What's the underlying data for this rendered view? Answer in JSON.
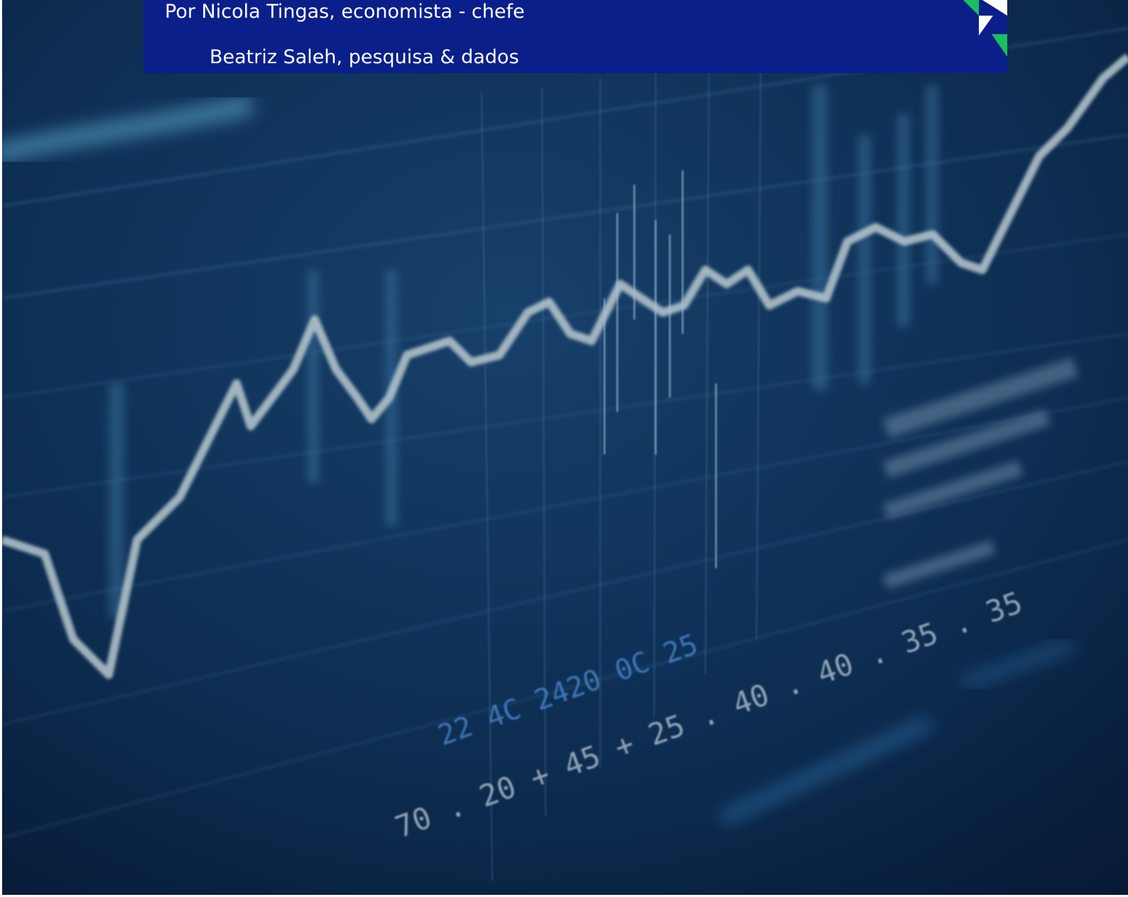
{
  "byline": {
    "author": "Por Nicola Tingas, economista - chefe",
    "contributor": "Beatriz Saleh, pesquisa & dados"
  },
  "background_photo": {
    "subject": "blurred financial data screen with line chart",
    "screen_text": [
      "22 4C 2420 0C 25",
      "70 . 20 + 45 + 25 . 40 . 40 . 35 . 35"
    ]
  },
  "colors": {
    "banner": "#0a1f8a",
    "text": "#ffffff",
    "brand_green": "#1bbf5e",
    "screen_bg": "#0b2a4f"
  },
  "icons": [
    "brand-logo-icon"
  ]
}
